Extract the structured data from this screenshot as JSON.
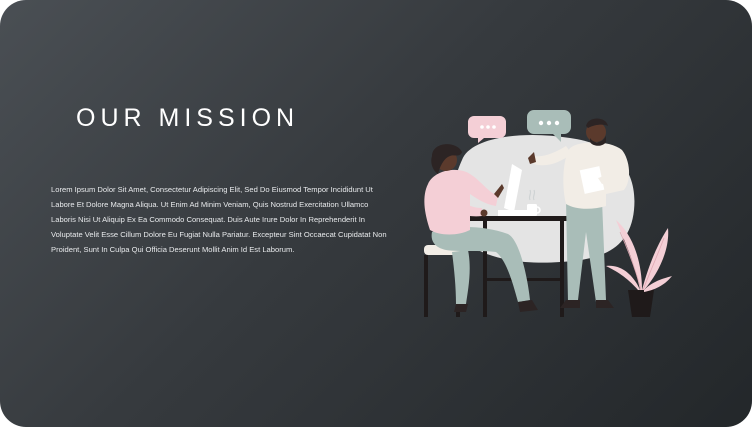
{
  "slide": {
    "title": "OUR MISSION",
    "body": "Lorem Ipsum Dolor Sit Amet, Consectetur Adipiscing Elit, Sed Do Eiusmod Tempor Incididunt Ut Labore Et Dolore Magna Aliqua. Ut Enim Ad Minim Veniam, Quis Nostrud Exercitation Ullamco Laboris Nisi Ut Aliquip Ex Ea Commodo Consequat. Duis Aute Irure Dolor In Reprehenderit In Voluptate Velit Esse Cillum Dolore Eu Fugiat Nulla Pariatur. Excepteur Sint Occaecat Cupidatat Non Proident, Sunt In Culpa Qui Officia Deserunt Mollit Anim Id Est Laborum."
  },
  "colors": {
    "background_start": "#4a4f54",
    "background_end": "#23272a",
    "pink": "#f4cfd6",
    "sage": "#a9bdb8",
    "cream": "#f2ede6",
    "dark": "#2c2424"
  },
  "illustration": {
    "icons": [
      "chat-bubble-pink-icon",
      "chat-bubble-sage-icon",
      "laptop-icon",
      "coffee-cup-icon",
      "plant-icon"
    ]
  }
}
